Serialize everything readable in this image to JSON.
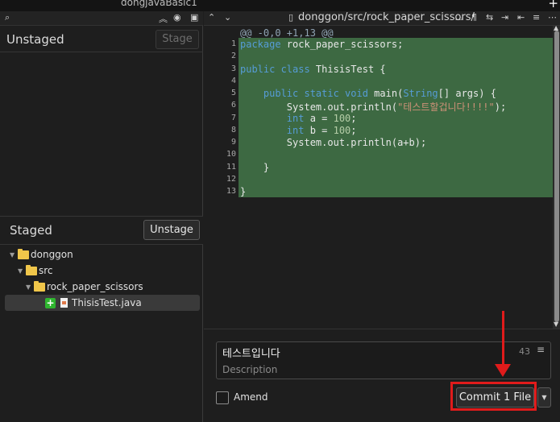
{
  "window": {
    "title": "dongjavaBasic1",
    "new_tab_icon": "plus-icon"
  },
  "left_toolbar": {
    "icons": [
      "search-icon",
      "collapse-all-icon",
      "eye-icon",
      "layout-icon"
    ]
  },
  "unstaged": {
    "title": "Unstaged",
    "stage_label": "Stage"
  },
  "staged": {
    "title": "Staged",
    "unstage_label": "Unstage",
    "tree": [
      {
        "label": "donggon",
        "type": "folder"
      },
      {
        "label": "src",
        "type": "folder"
      },
      {
        "label": "rock_paper_scissors",
        "type": "folder"
      },
      {
        "label": "ThisisTest.java",
        "type": "file",
        "status": "added"
      }
    ]
  },
  "diff": {
    "path": "donggon/src/rock_paper_scissors/",
    "hunk_header": "@@ -0,0 +1,13 @@",
    "lines": [
      {
        "n": "1",
        "text": "package rock_paper_scissors;"
      },
      {
        "n": "2",
        "text": ""
      },
      {
        "n": "3",
        "text": "public class ThisisTest {"
      },
      {
        "n": "4",
        "text": ""
      },
      {
        "n": "5",
        "text": "    public static void main(String[] args) {"
      },
      {
        "n": "6",
        "text": "        System.out.println(\"테스트할겁니다!!!!\");"
      },
      {
        "n": "7",
        "text": "        int a = 100;"
      },
      {
        "n": "8",
        "text": "        int b = 100;"
      },
      {
        "n": "9",
        "text": "        System.out.println(a+b);"
      },
      {
        "n": "10",
        "text": ""
      },
      {
        "n": "11",
        "text": "    }"
      },
      {
        "n": "12",
        "text": ""
      },
      {
        "n": "13",
        "text": "}"
      }
    ],
    "added_color": "#3d6942"
  },
  "commit": {
    "summary": "테스트입니다",
    "char_count": "43",
    "description_placeholder": "Description",
    "amend_label": "Amend",
    "commit_label": "Commit 1 File"
  },
  "annotation": {
    "color": "#e01b1b"
  }
}
